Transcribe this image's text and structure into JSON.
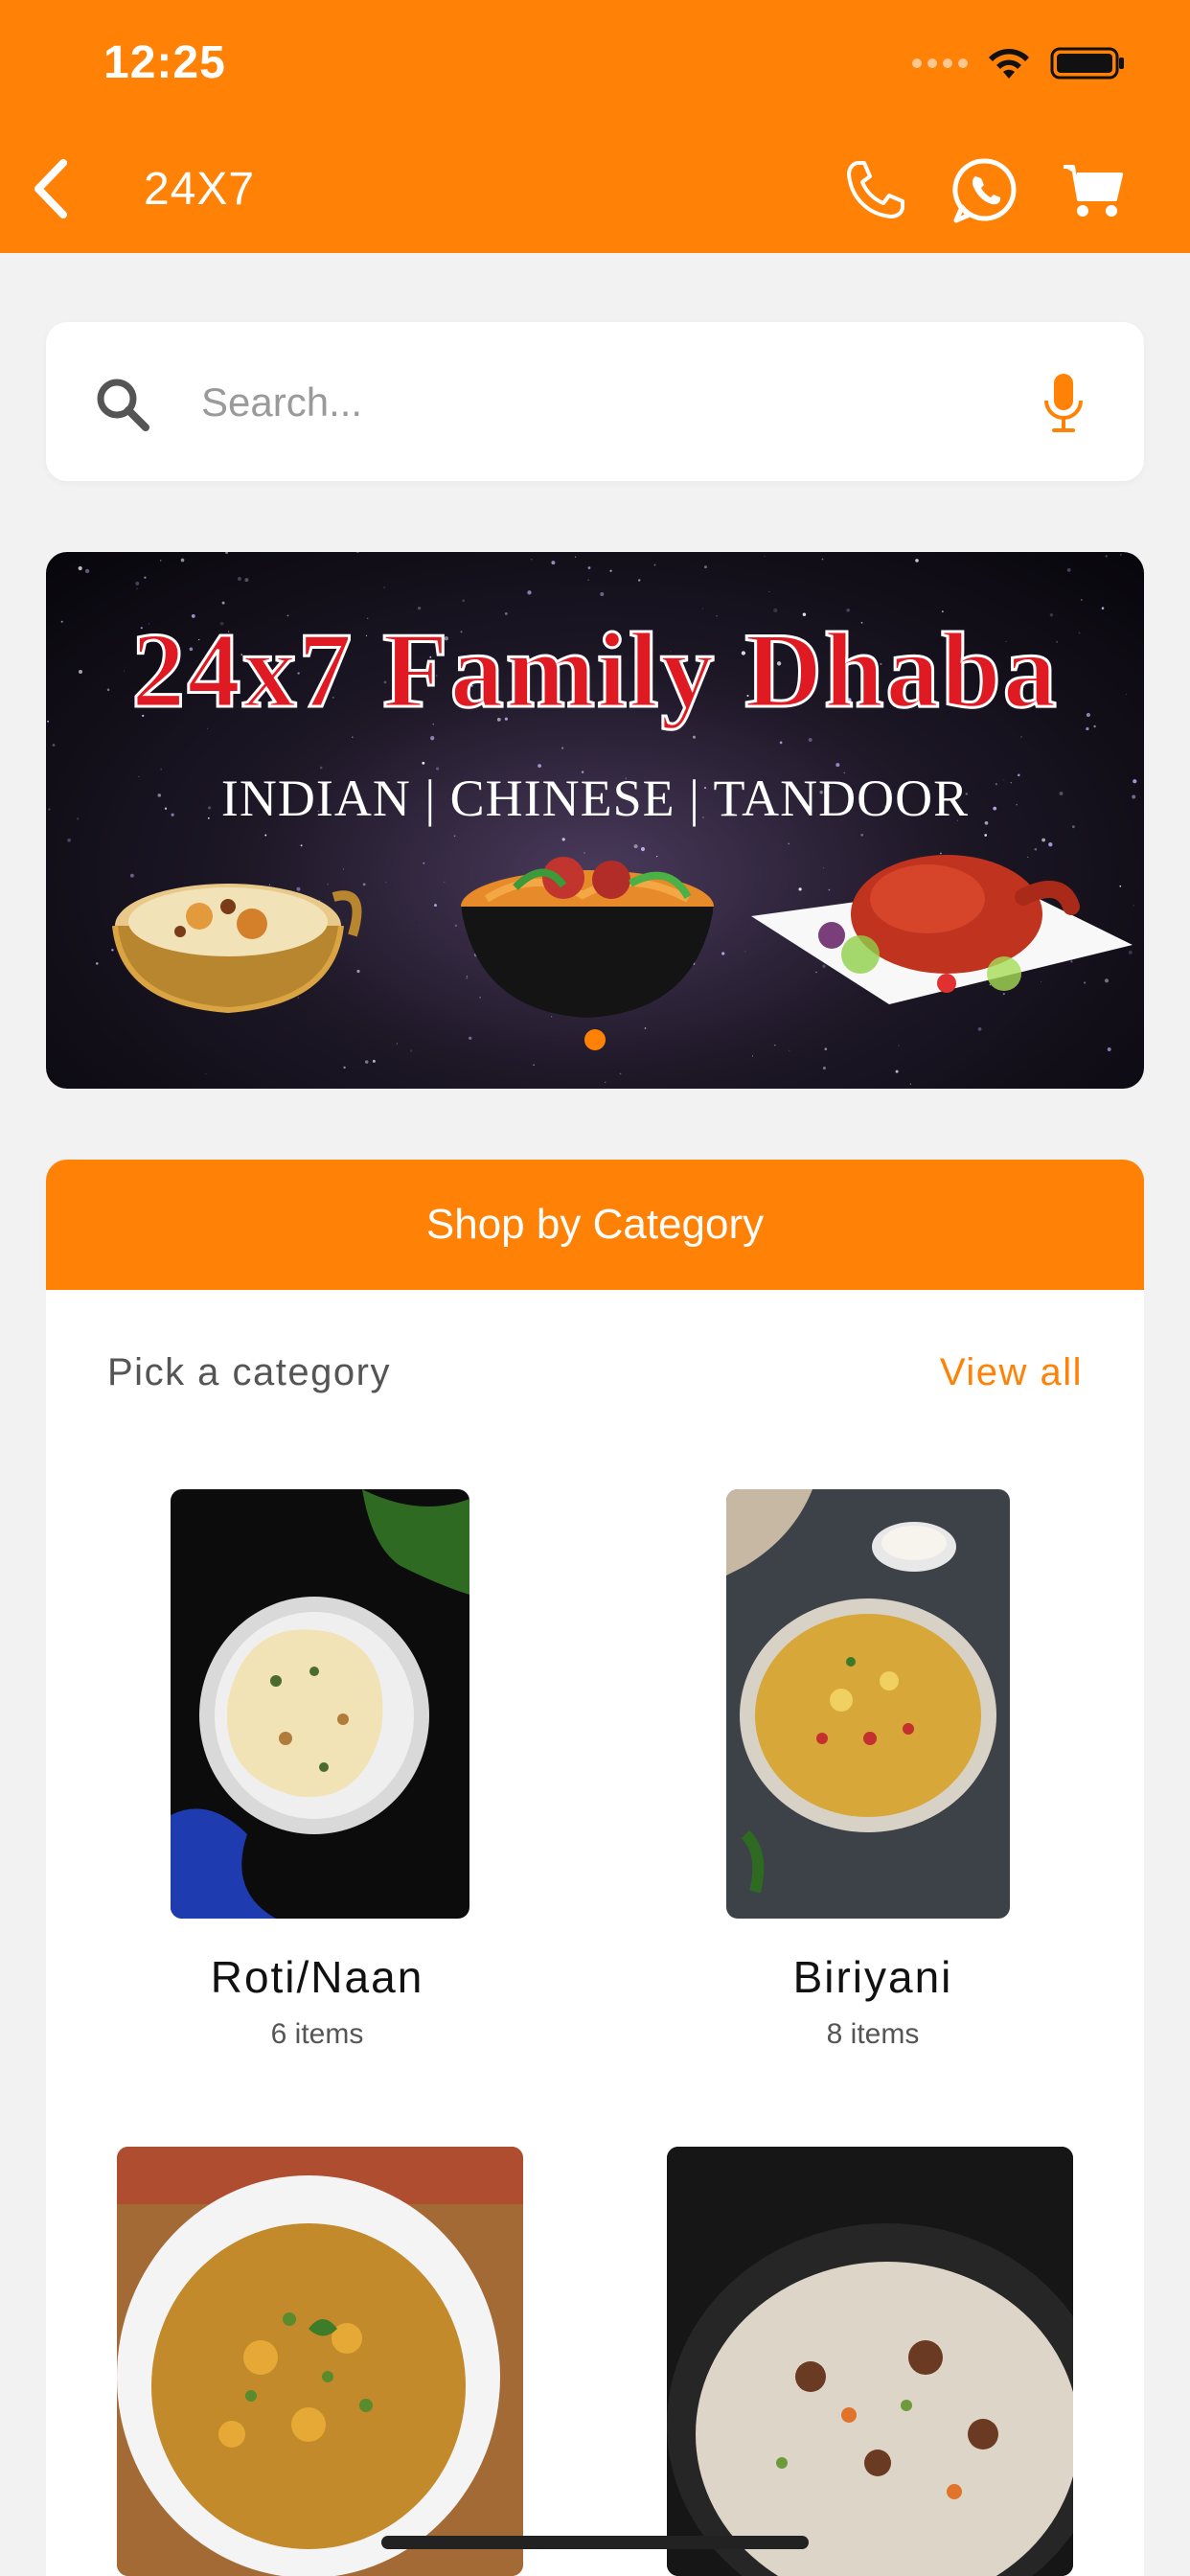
{
  "status_bar": {
    "time": "12:25"
  },
  "header": {
    "title": "24X7"
  },
  "search": {
    "placeholder": "Search..."
  },
  "banner": {
    "title": "24x7 Family Dhaba",
    "subtitle": "INDIAN | CHINESE | TANDOOR"
  },
  "category_section": {
    "header": "Shop by Category",
    "pick_label": "Pick a category",
    "view_all": "View all",
    "items": [
      {
        "name": "Roti/Naan",
        "count": "6 items"
      },
      {
        "name": "Biriyani",
        "count": "8 items"
      },
      {
        "name": "",
        "count": ""
      },
      {
        "name": "",
        "count": ""
      }
    ]
  },
  "colors": {
    "accent": "#ff8206",
    "banner_title": "#e01a22"
  },
  "icons": [
    "back-icon",
    "phone-icon",
    "whatsapp-icon",
    "cart-icon",
    "search-icon",
    "mic-icon",
    "wifi-icon",
    "battery-icon"
  ]
}
